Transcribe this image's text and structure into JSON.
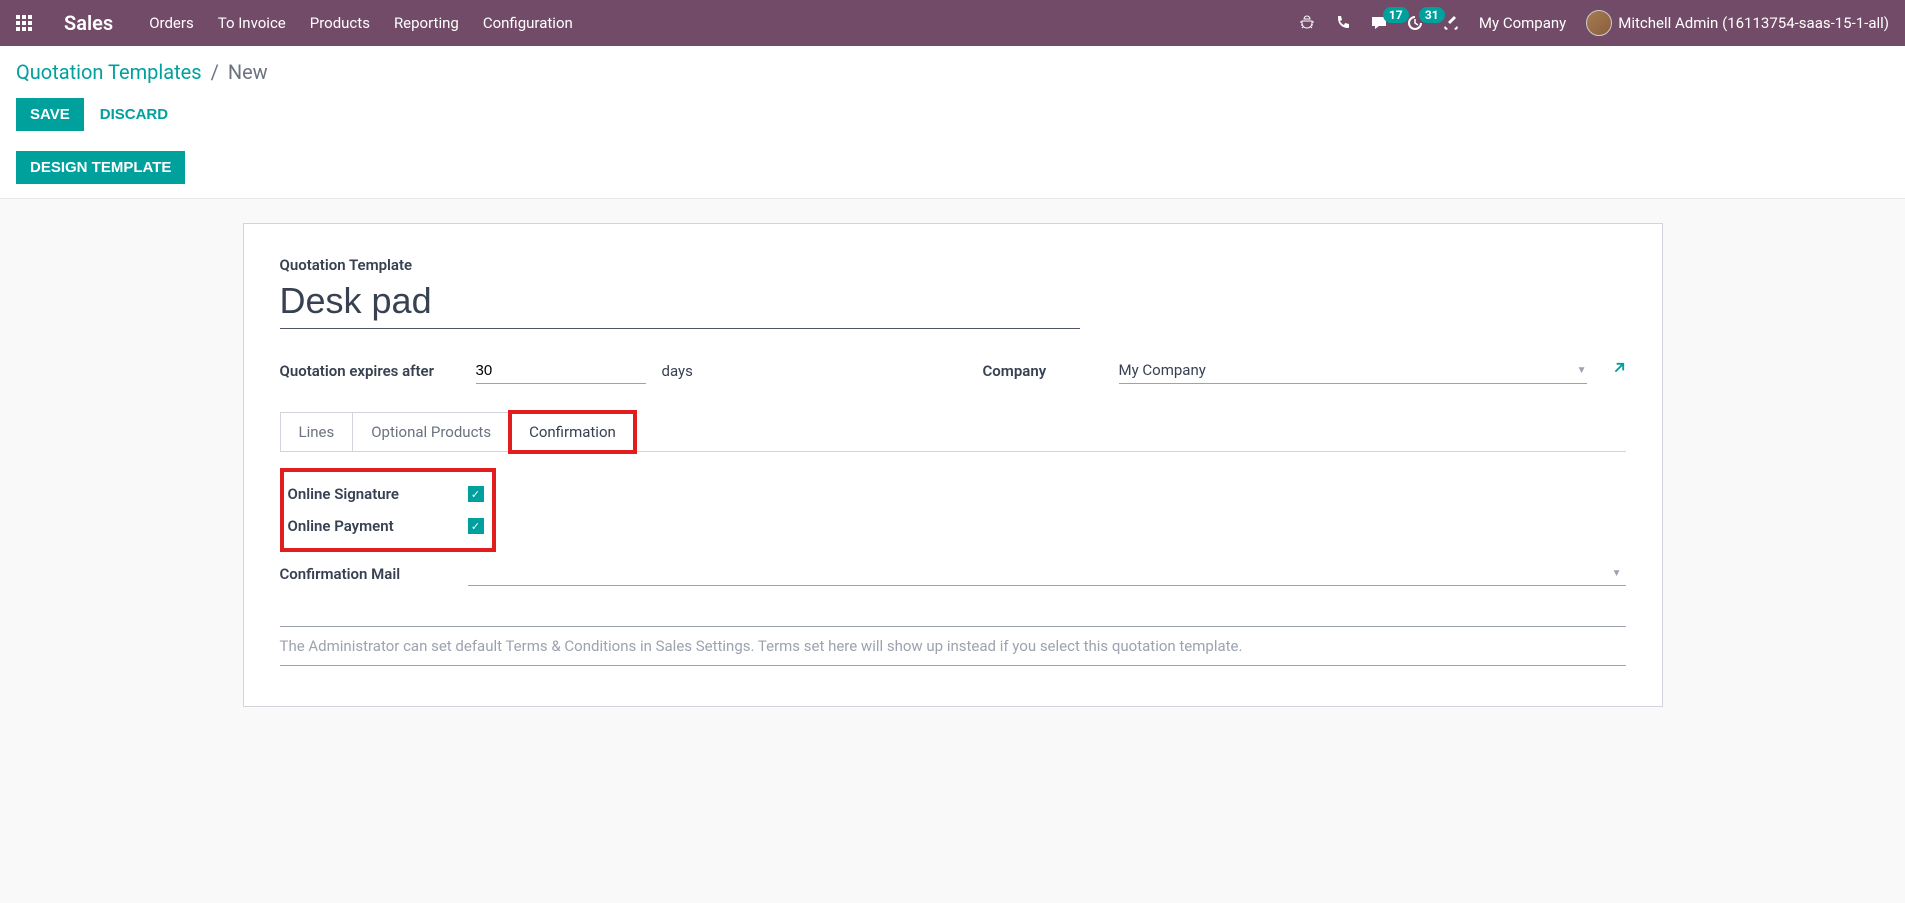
{
  "navbar": {
    "app_title": "Sales",
    "links": [
      "Orders",
      "To Invoice",
      "Products",
      "Reporting",
      "Configuration"
    ],
    "msg_badge": "17",
    "timer_badge": "31",
    "company": "My Company",
    "user": "Mitchell Admin (16113754-saas-15-1-all)"
  },
  "breadcrumb": {
    "parent": "Quotation Templates",
    "current": "New"
  },
  "actions": {
    "save": "SAVE",
    "discard": "DISCARD",
    "design": "DESIGN TEMPLATE"
  },
  "form": {
    "title_label": "Quotation Template",
    "title_value": "Desk pad",
    "expires_label": "Quotation expires after",
    "expires_value": "30",
    "expires_suffix": "days",
    "company_label": "Company",
    "company_value": "My Company"
  },
  "tabs": {
    "lines": "Lines",
    "optional": "Optional Products",
    "confirmation": "Confirmation"
  },
  "confirmation": {
    "online_signature": "Online Signature",
    "online_payment": "Online Payment",
    "confirmation_mail": "Confirmation Mail",
    "terms_placeholder": "The Administrator can set default Terms & Conditions in Sales Settings. Terms set here will show up instead if you select this quotation template."
  }
}
